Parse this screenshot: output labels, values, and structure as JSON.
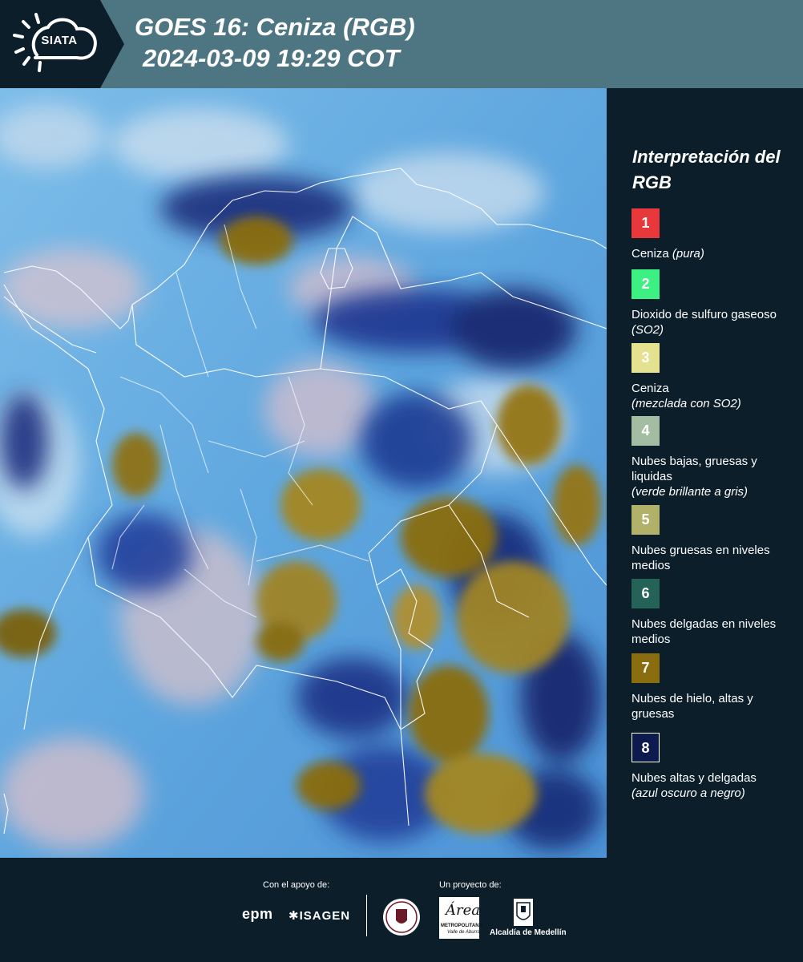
{
  "header": {
    "logo_text": "SIATA",
    "title_line1": "GOES 16: Ceniza (RGB)",
    "title_line2": "2024-03-09 19:29 COT"
  },
  "legend": {
    "title": "Interpretación del RGB",
    "items": [
      {
        "number": "1",
        "color": "#e8383b",
        "label": "Ceniza",
        "note": "(pura)"
      },
      {
        "number": "2",
        "color": "#3df083",
        "label": "Dioxido de sulfuro gaseoso",
        "note": "(SO2)"
      },
      {
        "number": "3",
        "color": "#e4e28e",
        "label": "Ceniza",
        "note": "(mezclada con SO2)"
      },
      {
        "number": "4",
        "color": "#a3bda2",
        "label": "Nubes bajas, gruesas y liquidas",
        "note": "(verde brillante a gris)"
      },
      {
        "number": "5",
        "color": "#b2b16a",
        "label": "Nubes gruesas en niveles medios",
        "note": ""
      },
      {
        "number": "6",
        "color": "#256257",
        "label": "Nubes delgadas en niveles medios",
        "note": ""
      },
      {
        "number": "7",
        "color": "#8a6d0e",
        "label": "Nubes de hielo, altas y gruesas",
        "note": ""
      },
      {
        "number": "8",
        "color": "#0c1a4e",
        "label": "Nubes altas y delgadas",
        "note": "(azul oscuro a negro)"
      }
    ]
  },
  "footer": {
    "support_label": "Con el apoyo de:",
    "project_label": "Un proyecto de:",
    "epm": "epm",
    "isagen": "ISAGEN",
    "area_title": "Área",
    "area_sub": "METROPOLITANA",
    "area_sub2": "Valle de Aburrá",
    "alcaldia": "Alcaldía de Medellín"
  },
  "colors": {
    "header_bg": "#4d7582",
    "logo_bg": "#0c1e2a",
    "panel_bg": "#0c1e2a",
    "map_sky_blue": "#6fb3e4",
    "map_ice_cloud": "#8a6d0e",
    "map_high_thin": "#0c1a4e"
  }
}
